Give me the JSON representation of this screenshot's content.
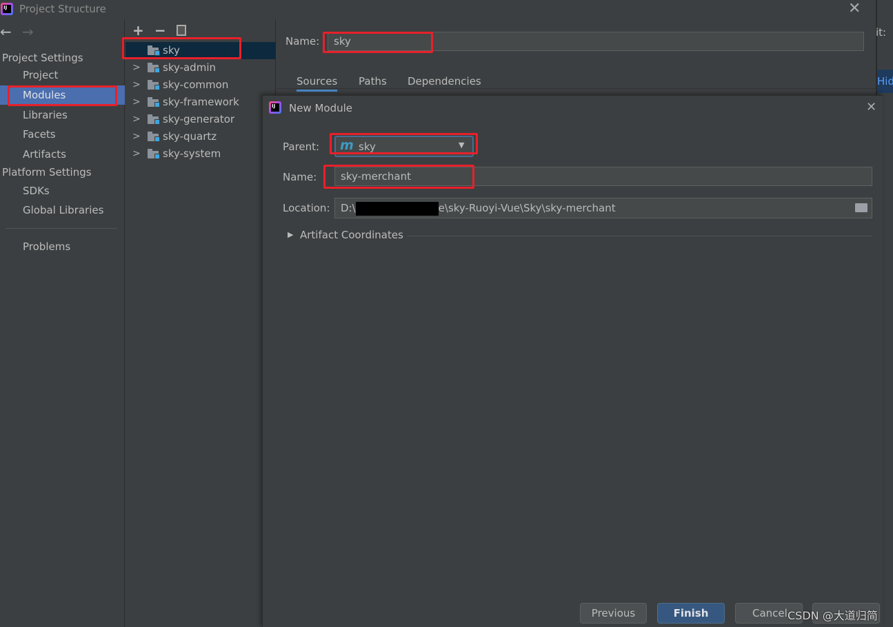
{
  "window": {
    "title": "Project Structure",
    "icon": "intellij-idea-icon"
  },
  "nav": {
    "back_icon": "arrow-left-icon",
    "forward_icon": "arrow-right-icon"
  },
  "sidebar": {
    "project_settings_header": "Project Settings",
    "project_settings_items": [
      {
        "label": "Project"
      },
      {
        "label": "Modules",
        "selected": true
      },
      {
        "label": "Libraries"
      },
      {
        "label": "Facets"
      },
      {
        "label": "Artifacts"
      }
    ],
    "platform_settings_header": "Platform Settings",
    "platform_settings_items": [
      {
        "label": "SDKs"
      },
      {
        "label": "Global Libraries"
      }
    ],
    "problems": "Problems"
  },
  "tree": {
    "toolbar": {
      "add": "+",
      "remove": "−",
      "copy_icon": "copy-icon"
    },
    "items": [
      {
        "label": "sky",
        "selected": true
      },
      {
        "label": "sky-admin"
      },
      {
        "label": "sky-common"
      },
      {
        "label": "sky-framework"
      },
      {
        "label": "sky-generator"
      },
      {
        "label": "sky-quartz"
      },
      {
        "label": "sky-system"
      }
    ]
  },
  "module_details": {
    "name_label": "Name:",
    "name_value": "sky",
    "tabs": [
      {
        "label": "Sources",
        "active": true
      },
      {
        "label": "Paths"
      },
      {
        "label": "Dependencies"
      }
    ],
    "partial_right_label": "it:",
    "partial_right_button": "Hid"
  },
  "new_module_dialog": {
    "title": "New Module",
    "parent_label": "Parent:",
    "parent_value": "sky",
    "parent_icon": "maven-m-icon",
    "name_label": "Name:",
    "name_value": "sky-merchant",
    "location_label": "Location:",
    "location_prefix": "D:\\",
    "location_suffix": "e\\sky-Ruoyi-Vue\\Sky\\sky-merchant",
    "artifact_coordinates": "Artifact Coordinates",
    "buttons": {
      "previous": "Previous",
      "finish": "Finish",
      "cancel": "Cancel"
    }
  },
  "watermark": "CSDN @大道归简",
  "colors": {
    "selection": "#4b6eaf",
    "tree_selection": "#0d293e",
    "annotation_red": "#e8202a",
    "primary_button": "#365880"
  }
}
